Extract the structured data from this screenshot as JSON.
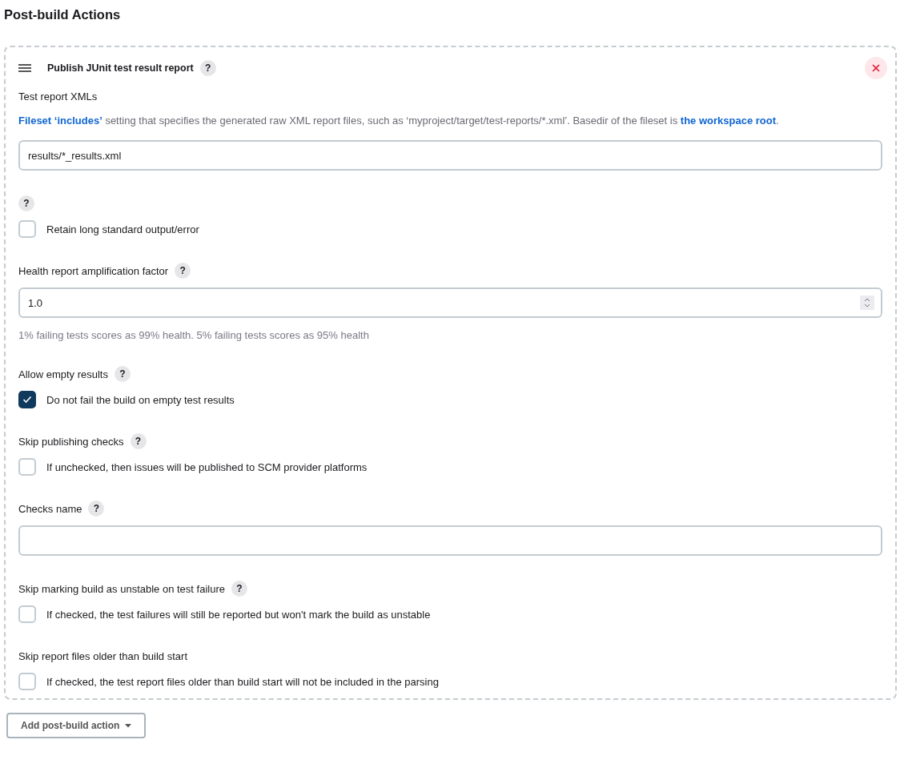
{
  "page_title": "Post-build Actions",
  "action": {
    "title": "Publish JUnit test result report",
    "help": "?",
    "sections": [
      {
        "kind": "text",
        "label": "Test report XMLs",
        "description": [
          {
            "text": "Fileset ‘includes’",
            "link": true
          },
          {
            "text": " setting that specifies the generated raw XML report files, such as ‘myproject/target/test-reports/*.xml’. Basedir of the fileset is ",
            "link": false
          },
          {
            "text": "the workspace root",
            "link": true
          },
          {
            "text": ".",
            "link": false
          }
        ],
        "value": "results/*_results.xml"
      },
      {
        "kind": "checkbox",
        "help": "?",
        "option": "Retain long standard output/error",
        "checked": false
      },
      {
        "kind": "number",
        "label": "Health report amplification factor",
        "help": "?",
        "value": "1.0",
        "hint": "1% failing tests scores as 99% health. 5% failing tests scores as 95% health"
      },
      {
        "kind": "checkbox",
        "label": "Allow empty results",
        "help": "?",
        "option": "Do not fail the build on empty test results",
        "checked": true
      },
      {
        "kind": "checkbox",
        "label": "Skip publishing checks",
        "help": "?",
        "option": "If unchecked, then issues will be published to SCM provider platforms",
        "checked": false
      },
      {
        "kind": "text",
        "label": "Checks name",
        "help": "?"
      },
      {
        "kind": "checkbox",
        "label": "Skip marking build as unstable on test failure",
        "help": "?",
        "option": "If checked, the test failures will still be reported but won't mark the build as unstable",
        "checked": false
      },
      {
        "kind": "checkbox",
        "label": "Skip report files older than build start",
        "option": "If checked, the test report files older than build start will not be included in the parsing",
        "checked": false
      }
    ]
  },
  "add_button": "Add post-build action"
}
